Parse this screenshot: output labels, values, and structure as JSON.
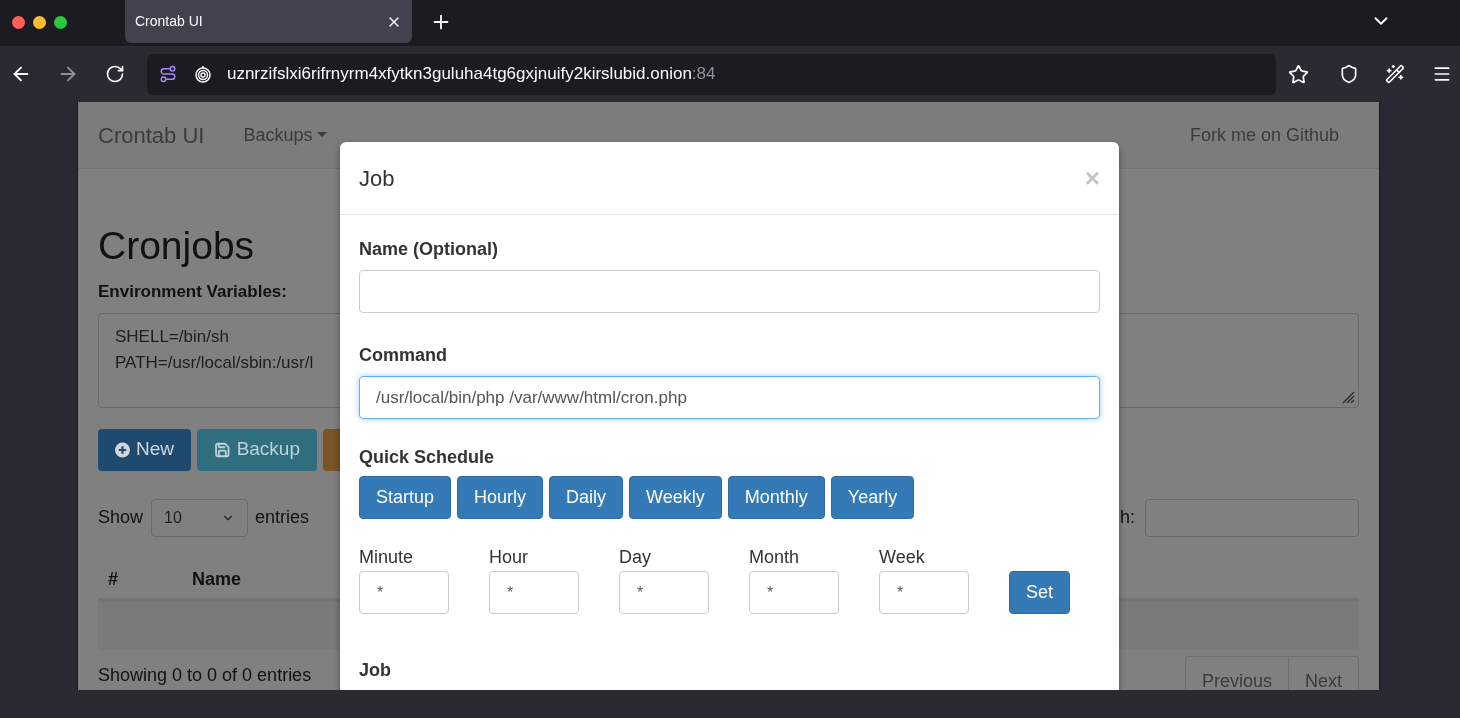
{
  "browser": {
    "tabs": [
      {
        "title": "Crontab UI",
        "selected": true
      }
    ],
    "address": {
      "host": "uznrzifslxi6rifrnyrm4xfytkn3guluha4tg6gxjnuify2kirslubid.onion",
      "port": ":84"
    }
  },
  "page": {
    "navbar": {
      "brand": "Crontab UI",
      "menus": [
        {
          "label": "Backups",
          "dropdown": true
        }
      ],
      "right_link": "Fork me on Github"
    },
    "heading": "Cronjobs",
    "env_label": "Environment Variables:",
    "env_lines": [
      "SHELL=/bin/sh",
      "PATH=/usr/local/sbin:/usr/l"
    ],
    "actions": [
      {
        "kind": "new",
        "label": "New"
      },
      {
        "kind": "backup",
        "label": "Backup"
      },
      {
        "kind": "warning"
      }
    ],
    "length": {
      "before": "Show",
      "value": "10",
      "after": "entries"
    },
    "search": {
      "label": "h:"
    },
    "table": {
      "columns": [
        "#",
        "Name"
      ]
    },
    "info": "Showing 0 to 0 of 0 entries",
    "pagination": [
      "Previous",
      "Next"
    ]
  },
  "modal": {
    "title": "Job",
    "close": "×",
    "fields": [
      {
        "label": "Name (Optional)",
        "focused": false
      },
      {
        "label": "Command",
        "value": "/usr/local/bin/php /var/www/html/cron.php",
        "focused": true
      }
    ],
    "quick_schedule": {
      "label": "Quick Schedule",
      "buttons": [
        "Startup",
        "Hourly",
        "Daily",
        "Weekly",
        "Monthly",
        "Yearly"
      ]
    },
    "schedule": [
      {
        "label": "Minute",
        "value": "*"
      },
      {
        "label": "Hour",
        "value": "*"
      },
      {
        "label": "Day",
        "value": "*"
      },
      {
        "label": "Month",
        "value": "*"
      },
      {
        "label": "Week",
        "value": "*"
      }
    ],
    "set_button": "Set",
    "section_label": "Job"
  }
}
